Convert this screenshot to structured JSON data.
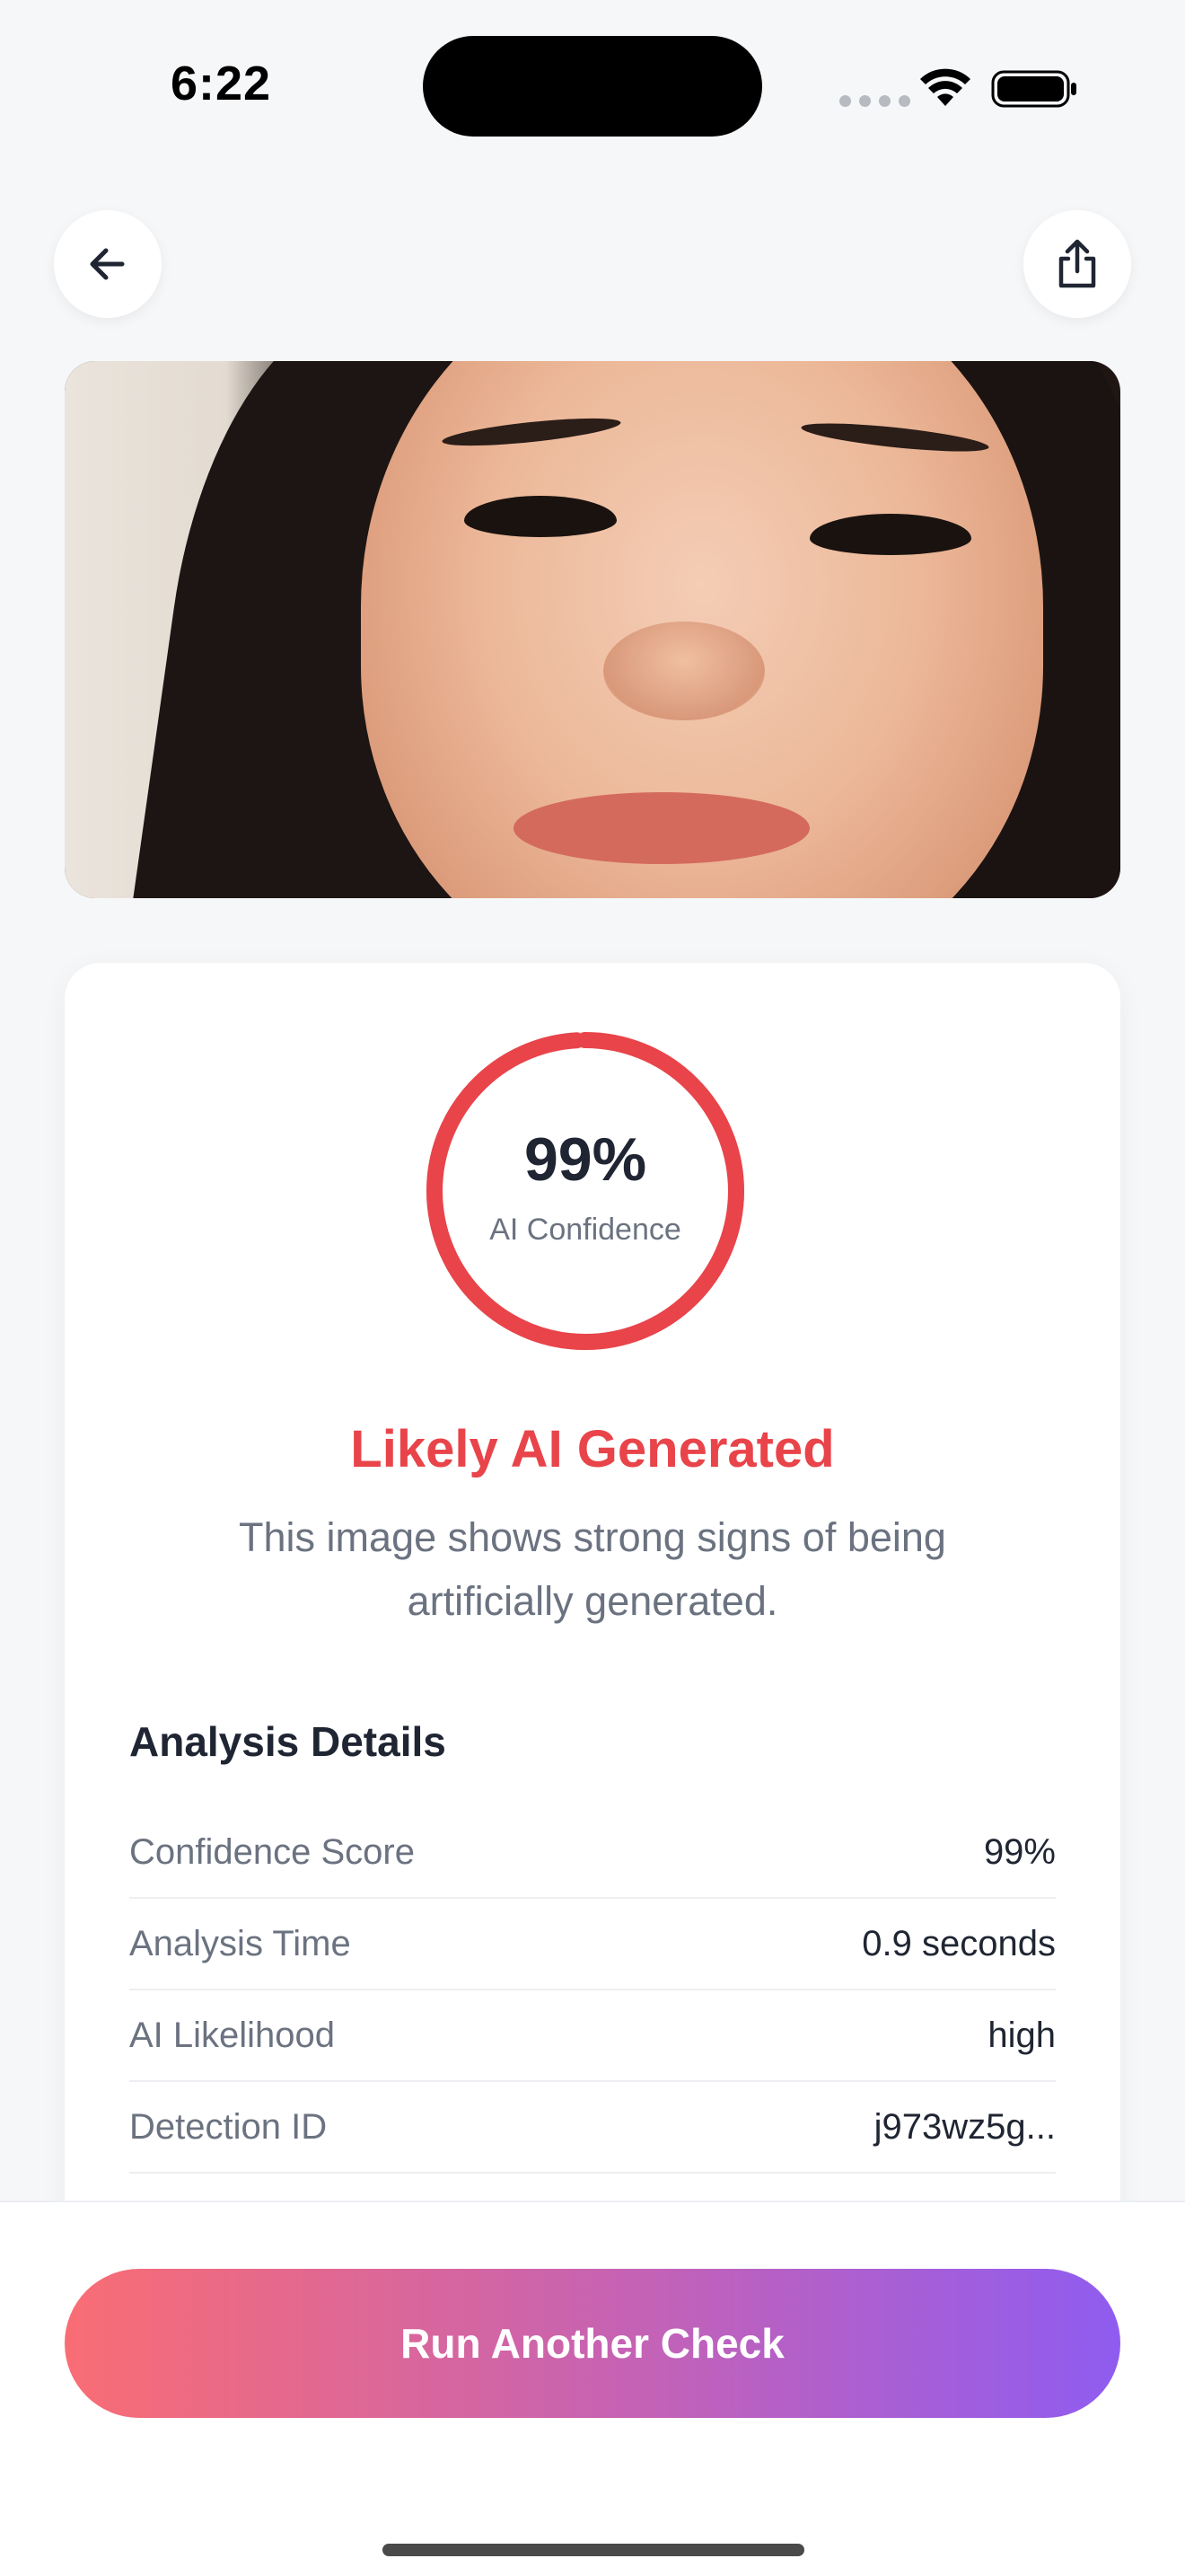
{
  "status_bar": {
    "time": "6:22"
  },
  "nav": {
    "back_icon": "arrow-left-icon",
    "share_icon": "share-icon"
  },
  "result": {
    "confidence_value": "99%",
    "confidence_label": "AI Confidence",
    "confidence_fraction": 0.99,
    "verdict": "Likely AI Generated",
    "description": "This image shows strong signs of being artificially generated.",
    "accent_color": "#e8444a"
  },
  "details": {
    "title": "Analysis Details",
    "rows": [
      {
        "label": "Confidence Score",
        "value": "99%"
      },
      {
        "label": "Analysis Time",
        "value": "0.9 seconds"
      },
      {
        "label": "AI Likelihood",
        "value": "high"
      },
      {
        "label": "Detection ID",
        "value": "j973wz5g..."
      }
    ]
  },
  "actions": {
    "run_again_label": "Run Another Check",
    "gradient_start": "#f96d74",
    "gradient_end": "#8f5cf0"
  }
}
